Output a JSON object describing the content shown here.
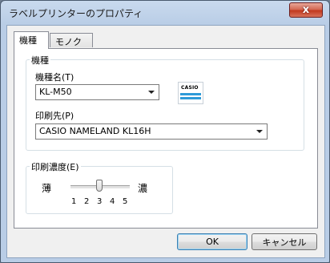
{
  "window": {
    "title": "ラベルプリンターのプロパティ",
    "close_symbol": "x"
  },
  "tabs": [
    {
      "label": "機種",
      "active": true
    },
    {
      "label": "モノクロ",
      "active": false
    }
  ],
  "model_group": {
    "legend": "機種",
    "model_name": {
      "label": "機種名(T)",
      "value": "KL-M50"
    },
    "printer_icon": {
      "brand_text": "CASIO",
      "accent_color": "#2e9ad8"
    },
    "destination": {
      "label": "印刷先(P)",
      "value": "CASIO NAMELAND KL16H"
    }
  },
  "density_group": {
    "legend": "印刷濃度(E)",
    "light_label": "薄",
    "dark_label": "濃",
    "ticks": [
      "1",
      "2",
      "3",
      "4",
      "5"
    ],
    "value": 3
  },
  "buttons": {
    "ok": "OK",
    "cancel": "キャンセル"
  }
}
